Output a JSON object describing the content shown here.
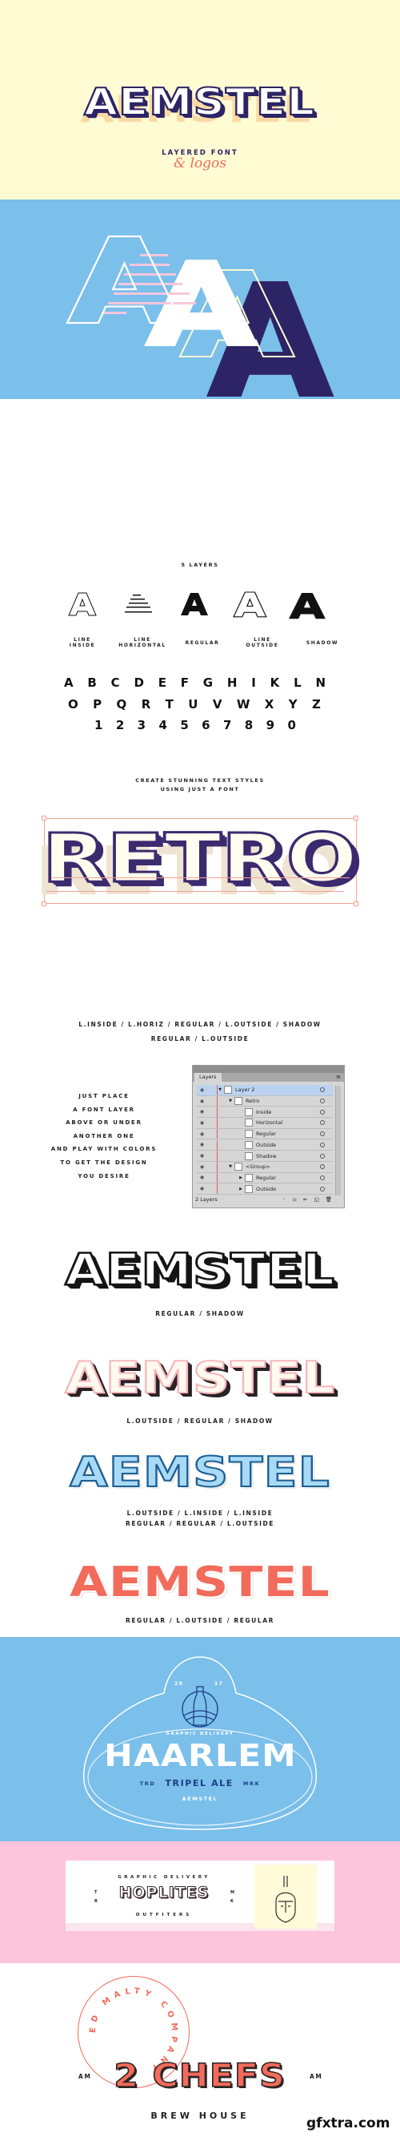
{
  "colors": {
    "cream": "#fffbd3",
    "blue": "#7bbfeb",
    "navy": "#2d2466",
    "coral": "#f26b5b",
    "pink": "#fdc5dc",
    "pale_pink": "#f6c7c9"
  },
  "hero": {
    "title": "AEMSTEL",
    "subtitle": "LAYERED FONT",
    "script": "& logos"
  },
  "layers": {
    "heading": "5 LAYERS",
    "items": [
      {
        "label1": "LINE",
        "label2": "INSIDE"
      },
      {
        "label1": "LINE",
        "label2": "HORIZONTAL"
      },
      {
        "label1": "",
        "label2": "REGULAR"
      },
      {
        "label1": "LINE",
        "label2": "OUTSIDE"
      },
      {
        "label1": "",
        "label2": "SHADOW"
      }
    ]
  },
  "alphabet": {
    "row1": [
      "A",
      "B",
      "C",
      "D",
      "E",
      "F",
      "G",
      "H",
      "I",
      "K",
      "L",
      "N"
    ],
    "row2": [
      "O",
      "P",
      "Q",
      "R",
      "T",
      "U",
      "V",
      "W",
      "X",
      "Y",
      "Z"
    ],
    "row3": [
      "1",
      "2",
      "3",
      "4",
      "5",
      "6",
      "7",
      "8",
      "9",
      "0"
    ]
  },
  "styles": {
    "line1": "CREATE STUNNING TEXT STYLES",
    "line2": "USING JUST A FONT",
    "retro": "RETRO",
    "cap1": "L.INSIDE / L.HORIZ / REGULAR / L.OUTSIDE / SHADOW",
    "cap2": "REGULAR / L.OUTSIDE"
  },
  "howto": [
    "JUST PLACE",
    "A FONT LAYER",
    "ABOVE OR UNDER",
    "ANOTHER ONE",
    "AND PLAY WITH COLORS",
    "TO GET THE DESIGN",
    "YOU DESIRE"
  ],
  "panel": {
    "tab": "Layers",
    "rows": [
      "Layer 2",
      "Retro",
      "Inside",
      "Horizontal",
      "Regular",
      "Outside",
      "Shadow",
      "<Group>",
      "Regular",
      "Outside"
    ],
    "footer": "2 Layers"
  },
  "samples": [
    {
      "text": "AEMSTEL",
      "caption": "REGULAR / SHADOW"
    },
    {
      "text": "AEMSTEL",
      "caption": "L.OUTSIDE / REGULAR / SHADOW"
    },
    {
      "text": "AEMSTEL",
      "caption": "L.OUTSIDE / L.INSIDE / L.INSIDE",
      "caption2": "REGULAR / REGULAR / L.OUTSIDE"
    },
    {
      "text": "AEMSTEL",
      "caption": "REGULAR / L.OUTSIDE / REGULAR"
    }
  ],
  "haarlem": {
    "year_left": "20",
    "year_right": "17",
    "ring": "GRAPHIC DELIVERY",
    "title": "HAARLEM",
    "left": "TRD",
    "middle": "TRIPEL ALE",
    "right": "MRK",
    "brand": "AEMSTEL"
  },
  "hoplites": {
    "top": "GRAPHIC DELIVERY",
    "title": "HOPLITES",
    "bottom": "OUTFITERS",
    "left_top": "T",
    "left_bottom": "R",
    "right_top": "M",
    "right_bottom": "K"
  },
  "chefs": {
    "ring": "RED MALTY COMPANY",
    "title": "2 CHEFS",
    "left": "AM",
    "right": "AM",
    "sub": "BREW HOUSE"
  },
  "watermark": "gfxtra.com"
}
